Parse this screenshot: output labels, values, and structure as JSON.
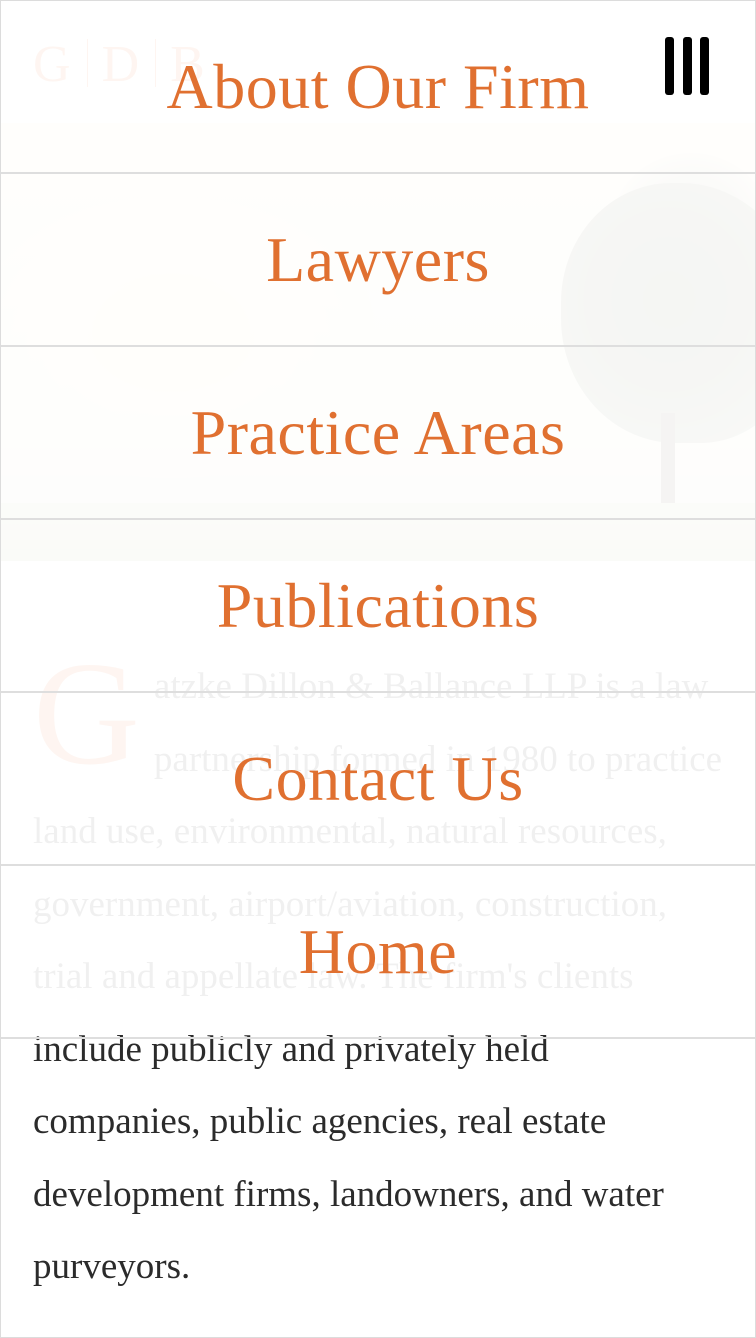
{
  "site": {
    "logo_letters": [
      "G",
      "D",
      "B"
    ]
  },
  "menu": {
    "items": [
      {
        "label": "About Our Firm"
      },
      {
        "label": "Lawyers"
      },
      {
        "label": "Practice Areas"
      },
      {
        "label": "Publications"
      },
      {
        "label": "Contact Us"
      },
      {
        "label": "Home"
      }
    ],
    "toggle_icon": "menu-icon",
    "accent_color": "#e07030"
  },
  "intro": {
    "dropcap": "G",
    "text": "atzke Dillon & Ballance LLP is a law partnership formed in 1980 to practice land use, environmental, natural resources, government, airport/aviation, construction, trial and appellate law. The firm's clients include publicly and privately held companies, public agencies, real estate development firms, landowners, and water purveyors."
  }
}
